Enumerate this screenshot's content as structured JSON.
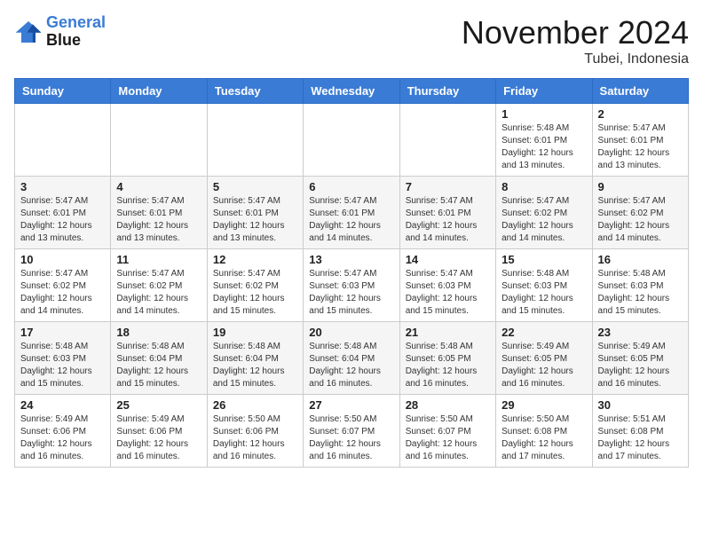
{
  "logo": {
    "line1": "General",
    "line2": "Blue"
  },
  "title": "November 2024",
  "location": "Tubei, Indonesia",
  "weekdays": [
    "Sunday",
    "Monday",
    "Tuesday",
    "Wednesday",
    "Thursday",
    "Friday",
    "Saturday"
  ],
  "weeks": [
    [
      {
        "day": "",
        "sunrise": "",
        "sunset": "",
        "daylight": ""
      },
      {
        "day": "",
        "sunrise": "",
        "sunset": "",
        "daylight": ""
      },
      {
        "day": "",
        "sunrise": "",
        "sunset": "",
        "daylight": ""
      },
      {
        "day": "",
        "sunrise": "",
        "sunset": "",
        "daylight": ""
      },
      {
        "day": "",
        "sunrise": "",
        "sunset": "",
        "daylight": ""
      },
      {
        "day": "1",
        "sunrise": "Sunrise: 5:48 AM",
        "sunset": "Sunset: 6:01 PM",
        "daylight": "Daylight: 12 hours and 13 minutes."
      },
      {
        "day": "2",
        "sunrise": "Sunrise: 5:47 AM",
        "sunset": "Sunset: 6:01 PM",
        "daylight": "Daylight: 12 hours and 13 minutes."
      }
    ],
    [
      {
        "day": "3",
        "sunrise": "Sunrise: 5:47 AM",
        "sunset": "Sunset: 6:01 PM",
        "daylight": "Daylight: 12 hours and 13 minutes."
      },
      {
        "day": "4",
        "sunrise": "Sunrise: 5:47 AM",
        "sunset": "Sunset: 6:01 PM",
        "daylight": "Daylight: 12 hours and 13 minutes."
      },
      {
        "day": "5",
        "sunrise": "Sunrise: 5:47 AM",
        "sunset": "Sunset: 6:01 PM",
        "daylight": "Daylight: 12 hours and 13 minutes."
      },
      {
        "day": "6",
        "sunrise": "Sunrise: 5:47 AM",
        "sunset": "Sunset: 6:01 PM",
        "daylight": "Daylight: 12 hours and 14 minutes."
      },
      {
        "day": "7",
        "sunrise": "Sunrise: 5:47 AM",
        "sunset": "Sunset: 6:01 PM",
        "daylight": "Daylight: 12 hours and 14 minutes."
      },
      {
        "day": "8",
        "sunrise": "Sunrise: 5:47 AM",
        "sunset": "Sunset: 6:02 PM",
        "daylight": "Daylight: 12 hours and 14 minutes."
      },
      {
        "day": "9",
        "sunrise": "Sunrise: 5:47 AM",
        "sunset": "Sunset: 6:02 PM",
        "daylight": "Daylight: 12 hours and 14 minutes."
      }
    ],
    [
      {
        "day": "10",
        "sunrise": "Sunrise: 5:47 AM",
        "sunset": "Sunset: 6:02 PM",
        "daylight": "Daylight: 12 hours and 14 minutes."
      },
      {
        "day": "11",
        "sunrise": "Sunrise: 5:47 AM",
        "sunset": "Sunset: 6:02 PM",
        "daylight": "Daylight: 12 hours and 14 minutes."
      },
      {
        "day": "12",
        "sunrise": "Sunrise: 5:47 AM",
        "sunset": "Sunset: 6:02 PM",
        "daylight": "Daylight: 12 hours and 15 minutes."
      },
      {
        "day": "13",
        "sunrise": "Sunrise: 5:47 AM",
        "sunset": "Sunset: 6:03 PM",
        "daylight": "Daylight: 12 hours and 15 minutes."
      },
      {
        "day": "14",
        "sunrise": "Sunrise: 5:47 AM",
        "sunset": "Sunset: 6:03 PM",
        "daylight": "Daylight: 12 hours and 15 minutes."
      },
      {
        "day": "15",
        "sunrise": "Sunrise: 5:48 AM",
        "sunset": "Sunset: 6:03 PM",
        "daylight": "Daylight: 12 hours and 15 minutes."
      },
      {
        "day": "16",
        "sunrise": "Sunrise: 5:48 AM",
        "sunset": "Sunset: 6:03 PM",
        "daylight": "Daylight: 12 hours and 15 minutes."
      }
    ],
    [
      {
        "day": "17",
        "sunrise": "Sunrise: 5:48 AM",
        "sunset": "Sunset: 6:03 PM",
        "daylight": "Daylight: 12 hours and 15 minutes."
      },
      {
        "day": "18",
        "sunrise": "Sunrise: 5:48 AM",
        "sunset": "Sunset: 6:04 PM",
        "daylight": "Daylight: 12 hours and 15 minutes."
      },
      {
        "day": "19",
        "sunrise": "Sunrise: 5:48 AM",
        "sunset": "Sunset: 6:04 PM",
        "daylight": "Daylight: 12 hours and 15 minutes."
      },
      {
        "day": "20",
        "sunrise": "Sunrise: 5:48 AM",
        "sunset": "Sunset: 6:04 PM",
        "daylight": "Daylight: 12 hours and 16 minutes."
      },
      {
        "day": "21",
        "sunrise": "Sunrise: 5:48 AM",
        "sunset": "Sunset: 6:05 PM",
        "daylight": "Daylight: 12 hours and 16 minutes."
      },
      {
        "day": "22",
        "sunrise": "Sunrise: 5:49 AM",
        "sunset": "Sunset: 6:05 PM",
        "daylight": "Daylight: 12 hours and 16 minutes."
      },
      {
        "day": "23",
        "sunrise": "Sunrise: 5:49 AM",
        "sunset": "Sunset: 6:05 PM",
        "daylight": "Daylight: 12 hours and 16 minutes."
      }
    ],
    [
      {
        "day": "24",
        "sunrise": "Sunrise: 5:49 AM",
        "sunset": "Sunset: 6:06 PM",
        "daylight": "Daylight: 12 hours and 16 minutes."
      },
      {
        "day": "25",
        "sunrise": "Sunrise: 5:49 AM",
        "sunset": "Sunset: 6:06 PM",
        "daylight": "Daylight: 12 hours and 16 minutes."
      },
      {
        "day": "26",
        "sunrise": "Sunrise: 5:50 AM",
        "sunset": "Sunset: 6:06 PM",
        "daylight": "Daylight: 12 hours and 16 minutes."
      },
      {
        "day": "27",
        "sunrise": "Sunrise: 5:50 AM",
        "sunset": "Sunset: 6:07 PM",
        "daylight": "Daylight: 12 hours and 16 minutes."
      },
      {
        "day": "28",
        "sunrise": "Sunrise: 5:50 AM",
        "sunset": "Sunset: 6:07 PM",
        "daylight": "Daylight: 12 hours and 16 minutes."
      },
      {
        "day": "29",
        "sunrise": "Sunrise: 5:50 AM",
        "sunset": "Sunset: 6:08 PM",
        "daylight": "Daylight: 12 hours and 17 minutes."
      },
      {
        "day": "30",
        "sunrise": "Sunrise: 5:51 AM",
        "sunset": "Sunset: 6:08 PM",
        "daylight": "Daylight: 12 hours and 17 minutes."
      }
    ]
  ]
}
